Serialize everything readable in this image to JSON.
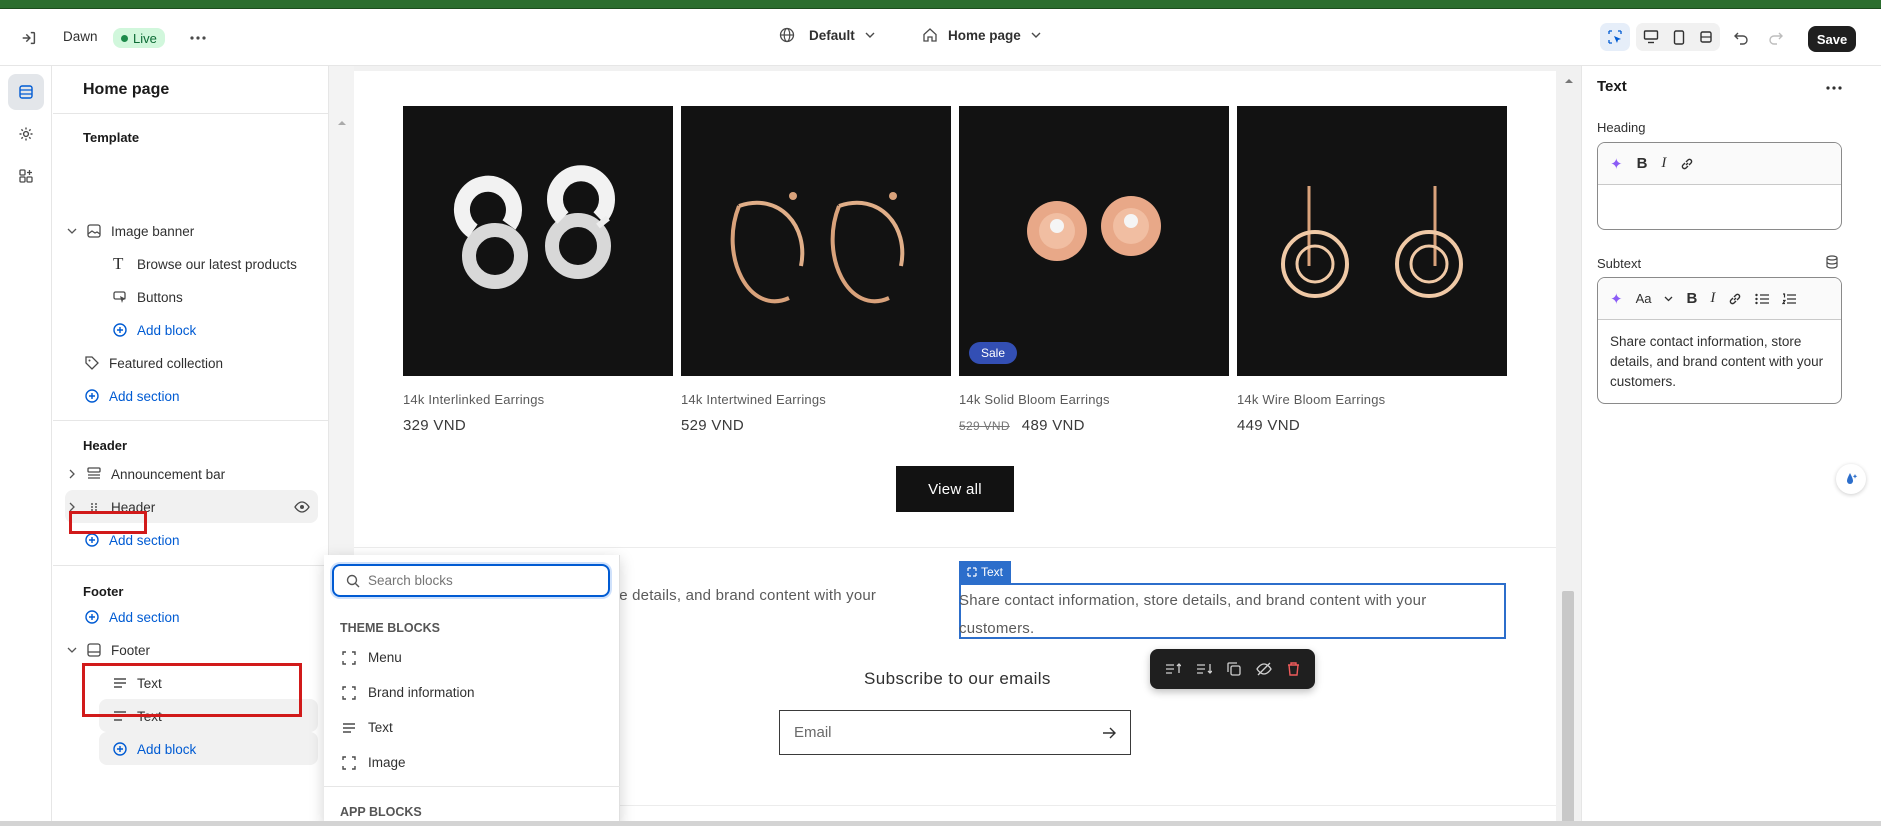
{
  "topbar": {
    "theme_name": "Dawn",
    "status": "Live",
    "preset": "Default",
    "page": "Home page",
    "save_label": "Save"
  },
  "left_panel": {
    "title": "Home page",
    "template_heading": "Template",
    "image_banner": "Image banner",
    "browse_text": "Browse our latest products",
    "buttons": "Buttons",
    "add_block": "Add block",
    "featured_collection": "Featured collection",
    "add_section": "Add section",
    "header_heading": "Header",
    "announcement_bar": "Announcement bar",
    "header_item": "Header",
    "footer_heading": "Footer",
    "footer_item": "Footer",
    "text_1": "Text",
    "text_2": "Text"
  },
  "products": [
    {
      "name": "14k Interlinked Earrings",
      "price": "329 VND",
      "old_price": "",
      "badge": ""
    },
    {
      "name": "14k Intertwined Earrings",
      "price": "529 VND",
      "old_price": "",
      "badge": ""
    },
    {
      "name": "14k Solid Bloom Earrings",
      "price": "489 VND",
      "old_price": "529 VND",
      "badge": "Sale"
    },
    {
      "name": "14k Wire Bloom Earrings",
      "price": "449 VND",
      "old_price": "",
      "badge": ""
    }
  ],
  "preview": {
    "view_all": "View all",
    "footer_text_left": "re details, and brand content with your",
    "footer_text_right": "Share contact information, store details, and brand content with your customers.",
    "text_badge": "Text",
    "subscribe_heading": "Subscribe to our emails",
    "email_placeholder": "Email"
  },
  "popover": {
    "search_placeholder": "Search blocks",
    "theme_blocks_heading": "THEME BLOCKS",
    "items": [
      "Menu",
      "Brand information",
      "Text",
      "Image"
    ],
    "app_blocks_heading": "APP BLOCKS"
  },
  "right_panel": {
    "title": "Text",
    "heading_label": "Heading",
    "subtext_label": "Subtext",
    "subtext_value": "Share contact information, store details, and brand content with your customers."
  },
  "colors": {
    "accent": "#005bd3",
    "highlight": "#d11a1a",
    "live_bg": "#d1f7dc",
    "sale_badge": "#334fb4"
  }
}
